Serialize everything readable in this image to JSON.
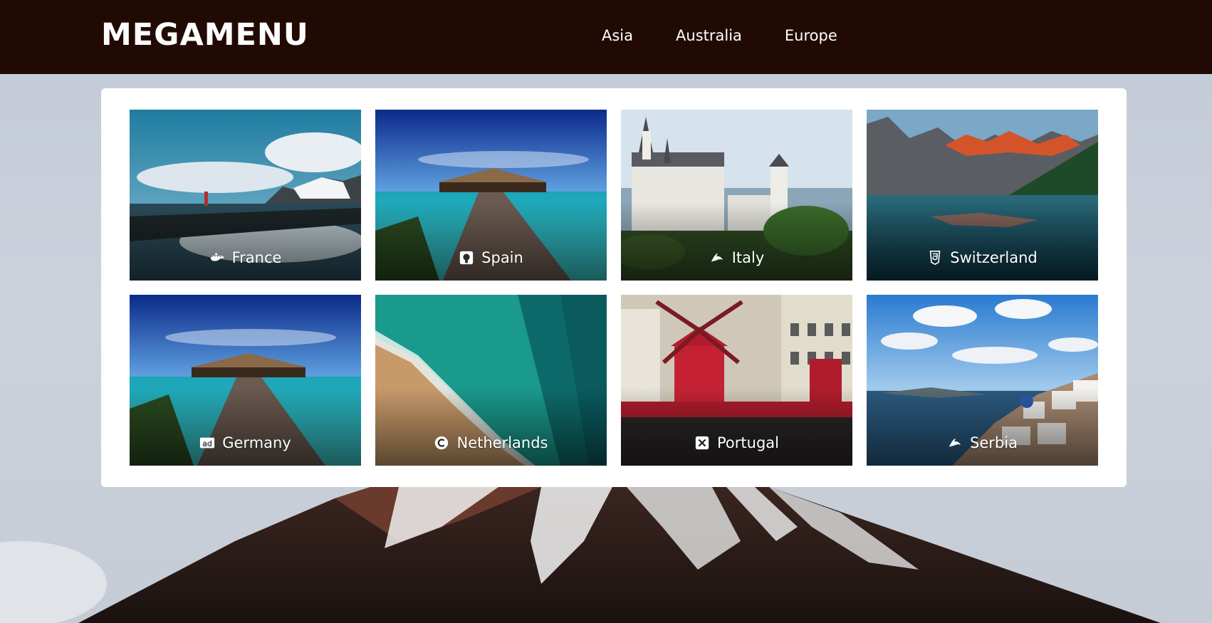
{
  "header": {
    "brand": "MEGAMENU",
    "nav": [
      {
        "label": "Asia"
      },
      {
        "label": "Australia"
      },
      {
        "label": "Europe"
      }
    ]
  },
  "menu": {
    "cards": [
      {
        "label": "France",
        "icon": "docker-icon"
      },
      {
        "label": "Spain",
        "icon": "github-square-icon"
      },
      {
        "label": "Italy",
        "icon": "affiliatetheme-icon"
      },
      {
        "label": "Switzerland",
        "icon": "css3-icon"
      },
      {
        "label": "Germany",
        "icon": "ad-icon"
      },
      {
        "label": "Netherlands",
        "icon": "creative-commons-icon"
      },
      {
        "label": "Portugal",
        "icon": "x-square-icon"
      },
      {
        "label": "Serbia",
        "icon": "affiliatetheme-icon"
      }
    ]
  },
  "colors": {
    "header_bg": "#220a04",
    "panel_bg": "#ffffff",
    "caption_text": "#ffffff"
  }
}
